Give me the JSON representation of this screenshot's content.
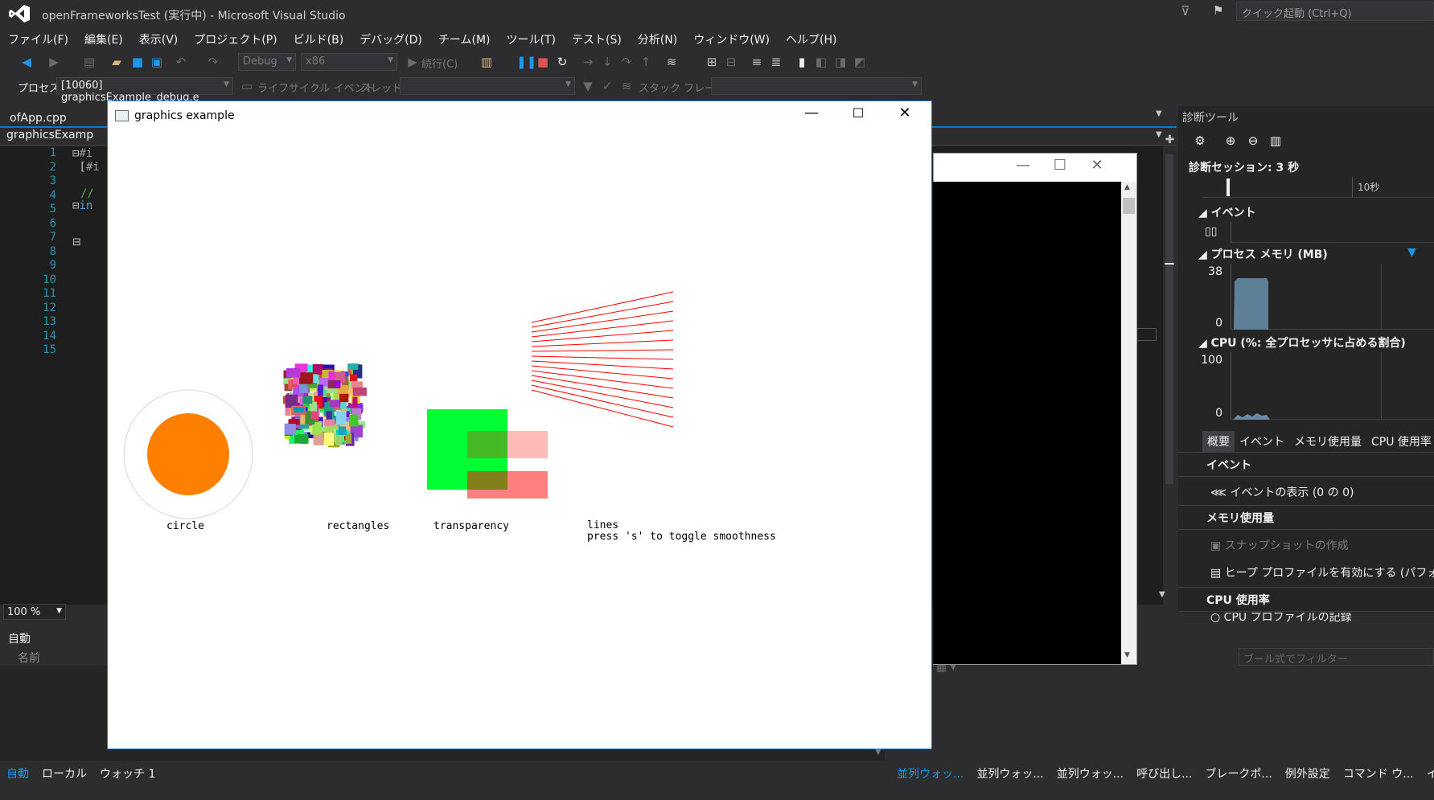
{
  "window": {
    "title": "openFrameworksTest (実行中) - Microsoft Visual Studio",
    "quick_launch_placeholder": "クイック起動 (Ctrl+Q)"
  },
  "menu": [
    "ファイル(F)",
    "編集(E)",
    "表示(V)",
    "プロジェクト(P)",
    "ビルド(B)",
    "デバッグ(D)",
    "チーム(M)",
    "ツール(T)",
    "テスト(S)",
    "分析(N)",
    "ウィンドウ(W)",
    "ヘルプ(H)"
  ],
  "toolbar": {
    "config": "Debug",
    "platform": "x86",
    "continue_label": "続行(C)",
    "process_label": "プロセス:",
    "process_value": "[10060] graphicsExample_debug.e",
    "lifecycle_label": "ライフサイクル イベント",
    "thread_label": "スレッド:",
    "stackframe_label": "スタック フレーム:"
  },
  "editor": {
    "doc_tab": "ofApp.cpp",
    "nav_combo": "graphicsExamp",
    "line_numbers": [
      "1",
      "2",
      "3",
      "4",
      "5",
      "6",
      "7",
      "8",
      "9",
      "10",
      "11",
      "12",
      "13",
      "14",
      "15"
    ],
    "code_fragments": [
      "#i",
      "#i",
      "//",
      "in"
    ],
    "zoom": "100 %"
  },
  "autos": {
    "header": "自動",
    "col_name": "名前",
    "filter_placeholder": "ブール式でフィルター"
  },
  "bottom_tabs_left": [
    "自動",
    "ローカル",
    "ウォッチ 1"
  ],
  "bottom_tabs_right": [
    "並列ウォッ...",
    "並列ウォッ...",
    "並列ウォッ...",
    "呼び出し...",
    "ブレークポ...",
    "例外設定",
    "コマンド ウ...",
    "イミデ"
  ],
  "diagnostics": {
    "title": "診断ツール",
    "session": "診断セッション: 3 秒",
    "timeline_label": "10秒",
    "events_section": "イベント",
    "memory_section": "プロセス メモリ (MB)",
    "memory_max": "38",
    "memory_min": "0",
    "cpu_section": "CPU (%: 全プロセッサに占める割合)",
    "cpu_max": "100",
    "cpu_min": "0",
    "tabs": [
      "概要",
      "イベント",
      "メモリ使用量",
      "CPU 使用率"
    ],
    "events_heading": "イベント",
    "events_show": "イベントの表示 (0 の 0)",
    "memory_heading": "メモリ使用量",
    "snapshot": "スナップショットの作成",
    "heap_profile": "ヒープ プロファイルを有効にする (パフォーマ",
    "cpu_heading": "CPU 使用率",
    "cpu_profile": "CPU プロファイルの記録",
    "memory_fill": 0.78,
    "accent": "#007acc"
  },
  "graphics_window": {
    "title": "graphics example",
    "labels": {
      "circle": "circle",
      "rectangles": "rectangles",
      "transparency": "transparency",
      "lines": "lines\npress 's' to toggle smoothness"
    },
    "circle_color": "#ff8000",
    "transparency_green": "#00ff33",
    "transparency_red": "#ff0000",
    "line_color": "#ff0000",
    "line_count": 15
  }
}
